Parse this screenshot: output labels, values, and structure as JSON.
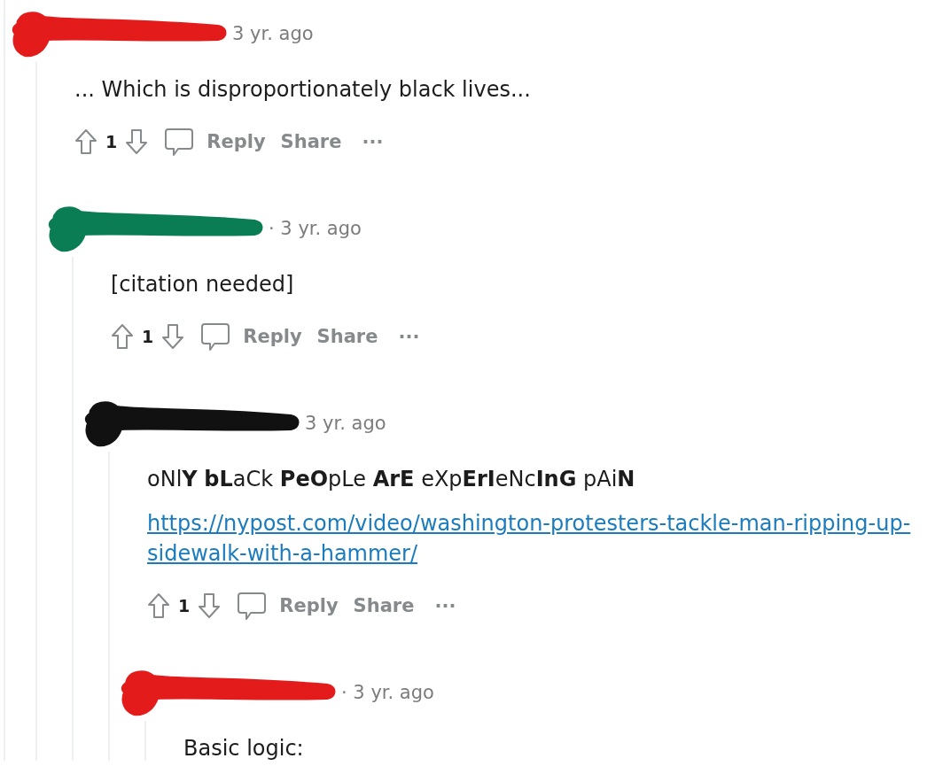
{
  "comments": [
    {
      "redaction": {
        "color": "#e31b1b"
      },
      "time": "3 yr. ago",
      "body": [
        "... Which is disproportionately black lives..."
      ],
      "actions": {
        "score": "1",
        "reply": "Reply",
        "share": "Share",
        "more": "···"
      },
      "children": [
        {
          "redaction": {
            "color": "#0a7d55"
          },
          "time": "· 3 yr. ago",
          "body": [
            "[citation needed]"
          ],
          "actions": {
            "score": "1",
            "reply": "Reply",
            "share": "Share",
            "more": "···"
          },
          "children": [
            {
              "redaction": {
                "color": "#111111"
              },
              "time": "3 yr. ago",
              "body": [
                "oNl**Y** **bL**aCk **PeO**pLe **ArE** eXp**ErI**eNc**InG** pAi**N**"
              ],
              "link": "https://nypost.com/video/washington-protesters-tackle-man-ripping-up-sidewalk-with-a-hammer/",
              "actions": {
                "score": "1",
                "reply": "Reply",
                "share": "Share",
                "more": "···"
              },
              "children": [
                {
                  "redaction": {
                    "color": "#e31b1b"
                  },
                  "time": "· 3 yr. ago",
                  "body": [
                    "Basic logic:"
                  ]
                }
              ]
            }
          ]
        }
      ]
    }
  ]
}
